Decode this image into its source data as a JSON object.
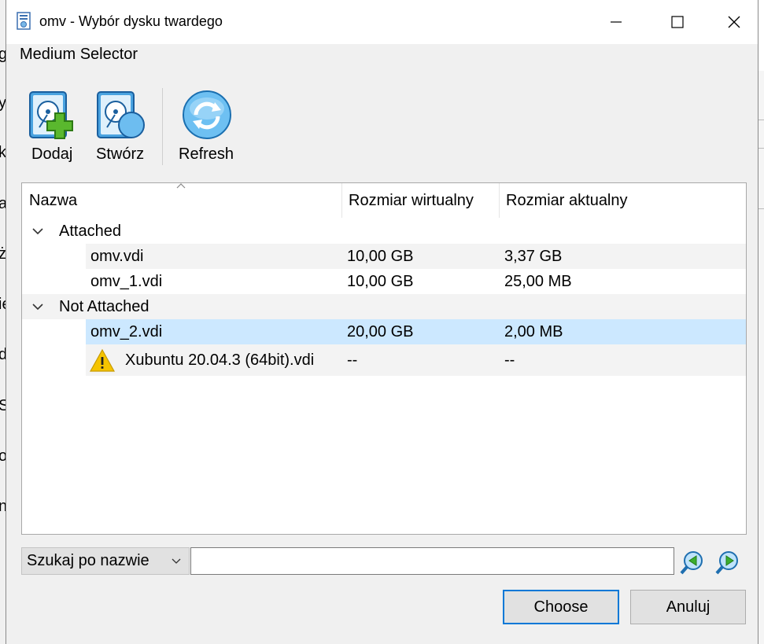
{
  "window": {
    "title": "omv - Wybór dysku twardego",
    "minimize_label": "Minimize",
    "maximize_label": "Maximize",
    "close_label": "Close"
  },
  "background_chars": [
    "g",
    "y",
    "k",
    "a",
    "ż",
    "ie",
    "d",
    "S",
    "o",
    "n"
  ],
  "dialog_title": "Medium Selector",
  "toolbar": {
    "add_label": "Dodaj",
    "create_label": "Stwórz",
    "refresh_label": "Refresh"
  },
  "table": {
    "columns": [
      "Nazwa",
      "Rozmiar wirtualny",
      "Rozmiar aktualny"
    ],
    "groups": [
      {
        "name": "Attached",
        "items": [
          {
            "name": "omv.vdi",
            "virtual": "10,00 GB",
            "actual": "3,37 GB"
          },
          {
            "name": "omv_1.vdi",
            "virtual": "10,00 GB",
            "actual": "25,00 MB"
          }
        ]
      },
      {
        "name": "Not Attached",
        "items": [
          {
            "name": "omv_2.vdi",
            "virtual": "20,00 GB",
            "actual": "2,00 MB",
            "selected": true
          },
          {
            "name": "Xubuntu 20.04.3 (64bit).vdi",
            "virtual": "--",
            "actual": "--",
            "warning": true
          }
        ]
      }
    ]
  },
  "search": {
    "mode_label": "Szukaj po nazwie",
    "value": "",
    "prev_icon": "search-previous-icon",
    "next_icon": "search-next-icon"
  },
  "buttons": {
    "choose_label": "Choose",
    "cancel_label": "Anuluj"
  },
  "colors": {
    "selection": "#cce8ff",
    "default_button_border": "#0078d7",
    "warning": "#f5c400"
  }
}
